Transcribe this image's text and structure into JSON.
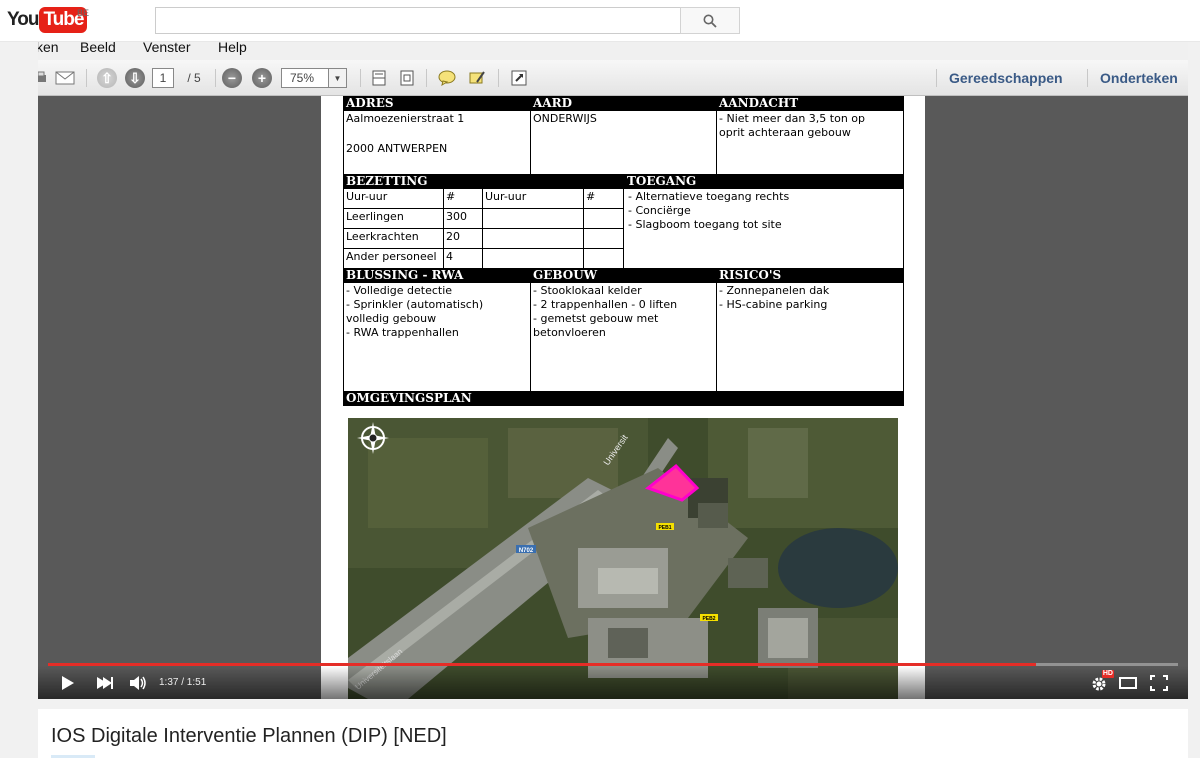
{
  "masthead": {
    "logo_you": "You",
    "logo_tube": "Tube",
    "region": "BE",
    "search_value": ""
  },
  "viewer": {
    "menu": [
      "ken",
      "Beeld",
      "Venster",
      "Help"
    ],
    "page_current": "1",
    "page_total": "/ 5",
    "zoom": "75%",
    "tools_link": "Gereedschappen",
    "sign_link": "Onderteken"
  },
  "document": {
    "adres_header": "ADRES",
    "aard_header": "AARD",
    "aandacht_header": "AANDACHT",
    "adres_line1": "Aalmoezenierstraat 1",
    "adres_line2": "2000 ANTWERPEN",
    "aard_value": "ONDERWIJS",
    "aandacht_line1": "- Niet meer dan 3,5 ton op",
    "aandacht_line2": "oprit achteraan gebouw",
    "bezetting_header": "BEZETTING",
    "toegang_header": "TOEGANG",
    "bez_col1": "Uur-uur",
    "bez_col2": "#",
    "bez_col3": "Uur-uur",
    "bez_col4": "#",
    "bez_rows": [
      {
        "label": "Leerlingen",
        "count": "300"
      },
      {
        "label": "Leerkrachten",
        "count": "20"
      },
      {
        "label": "Ander personeel",
        "count": "4"
      }
    ],
    "toegang_lines": [
      "- Alternatieve toegang rechts",
      "- Conciërge",
      "- Slagboom toegang tot site"
    ],
    "blussing_header": "BLUSSING - RWA",
    "gebouw_header": "GEBOUW",
    "risico_header": "RISICO'S",
    "blussing_lines": [
      "- Volledige detectie",
      "- Sprinkler (automatisch)",
      "volledig gebouw",
      "- RWA trappenhallen"
    ],
    "gebouw_lines": [
      "- Stooklokaal kelder",
      "- 2 trappenhallen - 0 liften",
      "- gemetst gebouw met",
      "betonvloeren"
    ],
    "risico_lines": [
      "- Zonnepanelen dak",
      "- HS-cabine parking"
    ],
    "omgeving_header": "OMGEVINGSPLAN",
    "map_labels": {
      "road": "N702",
      "peb1": "PEB1",
      "peb2": "PEB2",
      "street1": "Universit",
      "street2": "Universiteitslaan"
    }
  },
  "player": {
    "time": "1:37 / 1:51",
    "progress": 0.874,
    "hd_badge": "HD"
  },
  "video": {
    "title": "IOS Digitale Interventie Plannen (DIP) [NED]"
  },
  "colors": {
    "brand_red": "#e62117",
    "progress_red": "#e52d27",
    "tool_link": "#3a5a86",
    "map_highlight": "#ff3399"
  }
}
